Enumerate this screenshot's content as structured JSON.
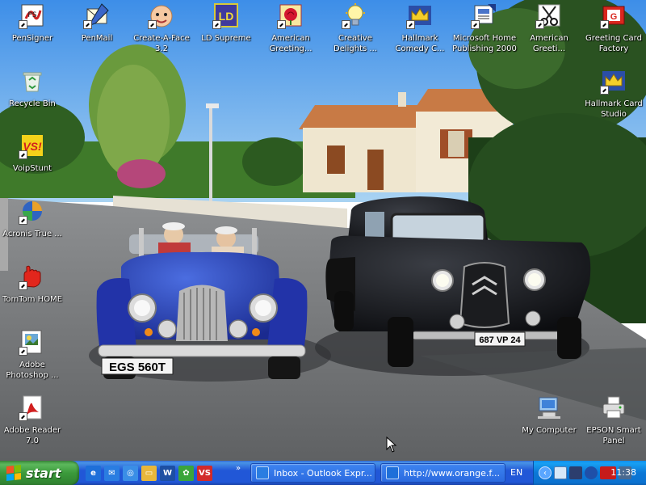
{
  "desktop": {
    "icons": [
      {
        "id": "pensigner",
        "label": "PenSigner",
        "icon": "pen-signer-icon"
      },
      {
        "id": "penmail",
        "label": "PenMail",
        "icon": "pen-mail-icon"
      },
      {
        "id": "createaface",
        "label": "Create-A-Face\n3.2",
        "icon": "face-icon"
      },
      {
        "id": "ldsupreme",
        "label": "LD Supreme",
        "icon": "ld-icon"
      },
      {
        "id": "amgreeting",
        "label": "American\nGreeting...",
        "icon": "rose-icon"
      },
      {
        "id": "creative",
        "label": "Creative\nDelights ...",
        "icon": "lightbulb-icon"
      },
      {
        "id": "hallmarkcom",
        "label": "Hallmark\nComedy C...",
        "icon": "crown-icon"
      },
      {
        "id": "mspub",
        "label": "Microsoft Home\nPublishing 2000",
        "icon": "publisher-icon"
      },
      {
        "id": "amgreeti2",
        "label": "American\nGreeti...",
        "icon": "scissors-icon"
      },
      {
        "id": "gcfactory",
        "label": "Greeting Card\nFactory",
        "icon": "card-factory-icon"
      },
      {
        "id": "recycle",
        "label": "Recycle Bin",
        "icon": "recycle-bin-icon"
      },
      {
        "id": "hallstudio",
        "label": "Hallmark Card\nStudio",
        "icon": "crown-icon"
      },
      {
        "id": "voipstunt",
        "label": "VoipStunt",
        "icon": "voipstunt-icon"
      },
      {
        "id": "acronis",
        "label": "Acronis True ...",
        "icon": "acronis-icon"
      },
      {
        "id": "tomtom",
        "label": "TomTom HOME",
        "icon": "tomtom-hand-icon"
      },
      {
        "id": "photoshop",
        "label": "Adobe\nPhotoshop ...",
        "icon": "photoshop-icon"
      },
      {
        "id": "reader",
        "label": "Adobe Reader\n7.0",
        "icon": "adobe-reader-icon"
      },
      {
        "id": "mycomputer",
        "label": "My Computer",
        "icon": "my-computer-icon"
      },
      {
        "id": "epson",
        "label": "EPSON Smart\nPanel",
        "icon": "printer-icon"
      }
    ],
    "plate_left": "EGS 560T",
    "plate_right": "687 VP 24"
  },
  "taskbar": {
    "start_label": "start",
    "quick_launch": [
      {
        "icon": "internet-explorer-icon",
        "color": "#1e6fd9",
        "glyph": "e"
      },
      {
        "icon": "outlook-express-icon",
        "color": "#2a7de1",
        "glyph": "✉"
      },
      {
        "icon": "media-icon",
        "color": "#3a8ee6",
        "glyph": "◎"
      },
      {
        "icon": "folder-icon",
        "color": "#e8b73a",
        "glyph": "▭"
      },
      {
        "icon": "word-icon",
        "color": "#1d4fa3",
        "glyph": "W"
      },
      {
        "icon": "puzzle-icon",
        "color": "#3ba53b",
        "glyph": "✿"
      },
      {
        "icon": "voipstunt-small-icon",
        "color": "#d22a2a",
        "glyph": "VS"
      }
    ],
    "chevron": "»",
    "tasks": [
      {
        "label": "Inbox - Outlook Expr...",
        "icon": "outlook-express-icon"
      },
      {
        "label": "http://www.orange.f...",
        "icon": "internet-explorer-icon"
      }
    ],
    "language": "EN",
    "tray_icons": [
      "network-icon",
      "volume-icon",
      "bluetooth-icon",
      "ati-icon",
      "monitor-icon"
    ],
    "clock": "11:38"
  },
  "colors": {
    "taskbar_blue": "#2157d7",
    "start_green": "#3b9a3b",
    "tray_blue": "#0b77d6"
  }
}
